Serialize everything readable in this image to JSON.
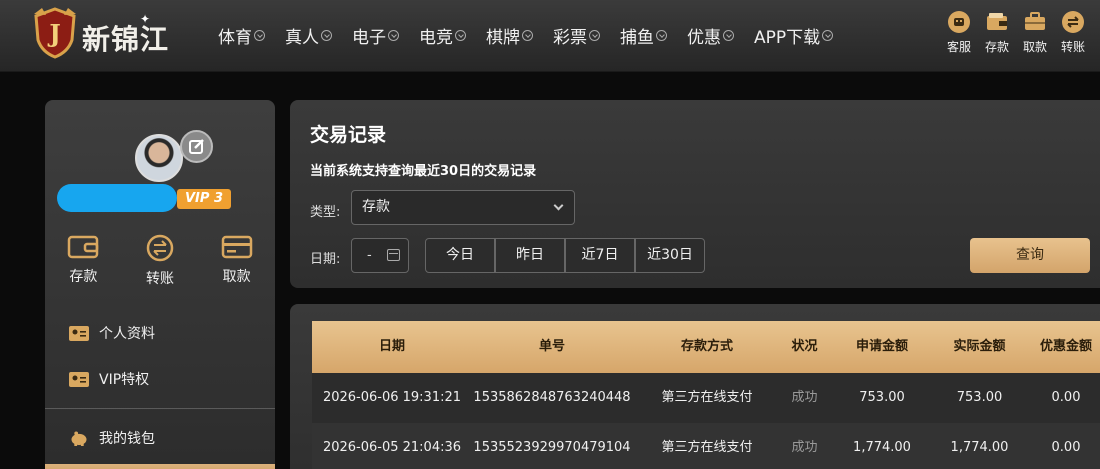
{
  "brand": {
    "name": "新锦江",
    "badge_letter": "J"
  },
  "nav": {
    "items": [
      {
        "label": "体育"
      },
      {
        "label": "真人"
      },
      {
        "label": "电子"
      },
      {
        "label": "电竞"
      },
      {
        "label": "棋牌"
      },
      {
        "label": "彩票"
      },
      {
        "label": "捕鱼"
      },
      {
        "label": "优惠"
      },
      {
        "label": "APP下载"
      }
    ]
  },
  "quick": {
    "items": [
      {
        "label": "客服",
        "icon": "support-icon"
      },
      {
        "label": "存款",
        "icon": "wallet-icon"
      },
      {
        "label": "取款",
        "icon": "briefcase-icon"
      },
      {
        "label": "转账",
        "icon": "transfer-icon"
      }
    ]
  },
  "profile": {
    "vip_level": "VIP 3"
  },
  "wallet_actions": {
    "deposit": "存款",
    "transfer": "转账",
    "withdraw": "取款"
  },
  "menu": {
    "items": [
      {
        "label": "个人资料"
      },
      {
        "label": "VIP特权"
      },
      {
        "label": "我的钱包"
      }
    ]
  },
  "records": {
    "title": "交易记录",
    "subtitle": "当前系统支持查询最近30日的交易记录",
    "type_label": "类型:",
    "type_value": "存款",
    "date_label": "日期:",
    "date_value": "-",
    "ranges": [
      "今日",
      "昨日",
      "近7日",
      "近30日"
    ],
    "query_button": "查询"
  },
  "table": {
    "headers": [
      "日期",
      "单号",
      "存款方式",
      "状况",
      "申请金额",
      "实际金额",
      "优惠金额"
    ],
    "rows": [
      [
        "2026-06-06 19:31:21",
        "1535862848763240448",
        "第三方在线支付",
        "成功",
        "753.00",
        "753.00",
        "0.00"
      ],
      [
        "2026-06-05 21:04:36",
        "1535523929970479104",
        "第三方在线支付",
        "成功",
        "1,774.00",
        "1,774.00",
        "0.00"
      ]
    ]
  },
  "colors": {
    "accent_gold": "#d6a66a",
    "vip_orange": "#f0a030",
    "redaction_blue": "#17a6ef"
  }
}
